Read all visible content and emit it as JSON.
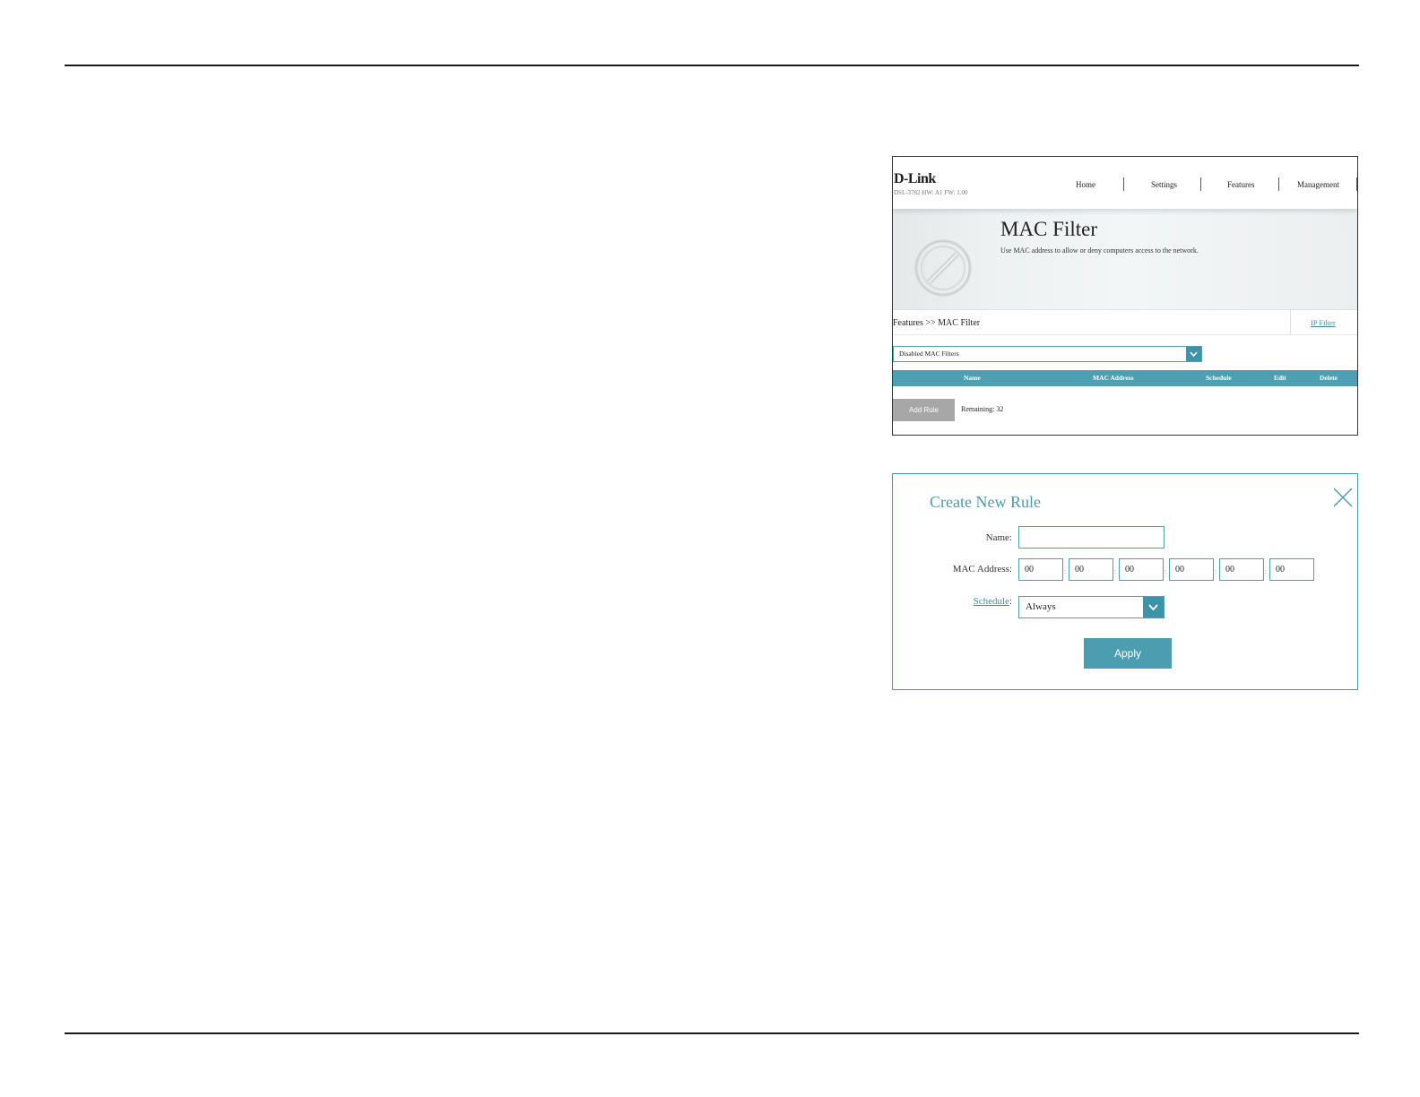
{
  "mac_filter_page": {
    "logo": "D-Link",
    "logo_sub": "DSL-3782   HW: A1   FW: 1.00",
    "nav": [
      "Home",
      "Settings",
      "Features",
      "Management"
    ],
    "title": "MAC Filter",
    "description": "Use MAC address to allow or deny computers access to the network.",
    "breadcrumb": "Features >> MAC Filter",
    "ip_filter_link": "IP Filter",
    "filter_mode": "Disabled MAC Filters",
    "table_headers": [
      "Name",
      "MAC Address",
      "Schedule",
      "Edit",
      "Delete"
    ],
    "add_rule_label": "Add Rule",
    "remaining": "Remaining: 32"
  },
  "create_rule_dialog": {
    "title": "Create New Rule",
    "name_label": "Name:",
    "name_value": "",
    "mac_label": "MAC Address:",
    "mac_octets": [
      "00",
      "00",
      "00",
      "00",
      "00",
      "00"
    ],
    "mac_separator": ":",
    "schedule_label": "Schedule",
    "schedule_colon": ":",
    "schedule_value": "Always",
    "apply_label": "Apply"
  },
  "colors": {
    "accent": "#4e9fb1",
    "button_gray": "#a7a7a7",
    "link": "#3a8ea4"
  }
}
